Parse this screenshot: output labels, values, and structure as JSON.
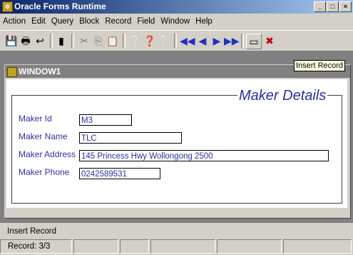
{
  "window": {
    "title": "Oracle Forms Runtime"
  },
  "menu": [
    "Action",
    "Edit",
    "Query",
    "Block",
    "Record",
    "Field",
    "Window",
    "Help"
  ],
  "tooltip": "Insert Record",
  "child": {
    "title": "WINDOW1",
    "frame_title": "Maker Details",
    "fields": {
      "maker_id": {
        "label": "Maker Id",
        "value": "M3"
      },
      "maker_name": {
        "label": "Maker Name",
        "value": "TLC"
      },
      "maker_address": {
        "label": "Maker Address",
        "value": "145 Princess Hwy Wollongong 2500"
      },
      "maker_phone": {
        "label": "Maker Phone",
        "value": "0242589531"
      }
    }
  },
  "status": {
    "message": "Insert Record",
    "record": "Record: 3/3"
  }
}
